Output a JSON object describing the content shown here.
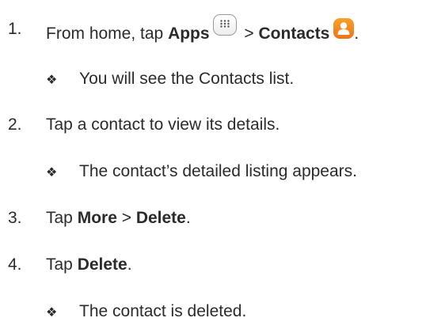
{
  "steps": [
    {
      "num": "1.",
      "parts": {
        "a": "From home, tap ",
        "b": "Apps",
        "c": " > ",
        "d": "Contacts",
        "e": "."
      }
    },
    {
      "num": "2.",
      "text": "Tap a contact to view its details."
    },
    {
      "num": "3.",
      "parts": {
        "a": "Tap ",
        "b": "More",
        "c": " > ",
        "d": "Delete",
        "e": "."
      }
    },
    {
      "num": "4.",
      "parts": {
        "a": "Tap ",
        "b": "Delete",
        "c": "."
      }
    }
  ],
  "bullets": [
    "You will see the Contacts list.",
    "The contact’s detailed listing appears.",
    "The contact is deleted."
  ],
  "bullet_symbol": "❖",
  "icons": {
    "apps": "apps-grid-icon",
    "contacts": "contacts-app-icon"
  },
  "colors": {
    "text": "#2b2b2b",
    "contacts_icon": "#f08a1e"
  }
}
